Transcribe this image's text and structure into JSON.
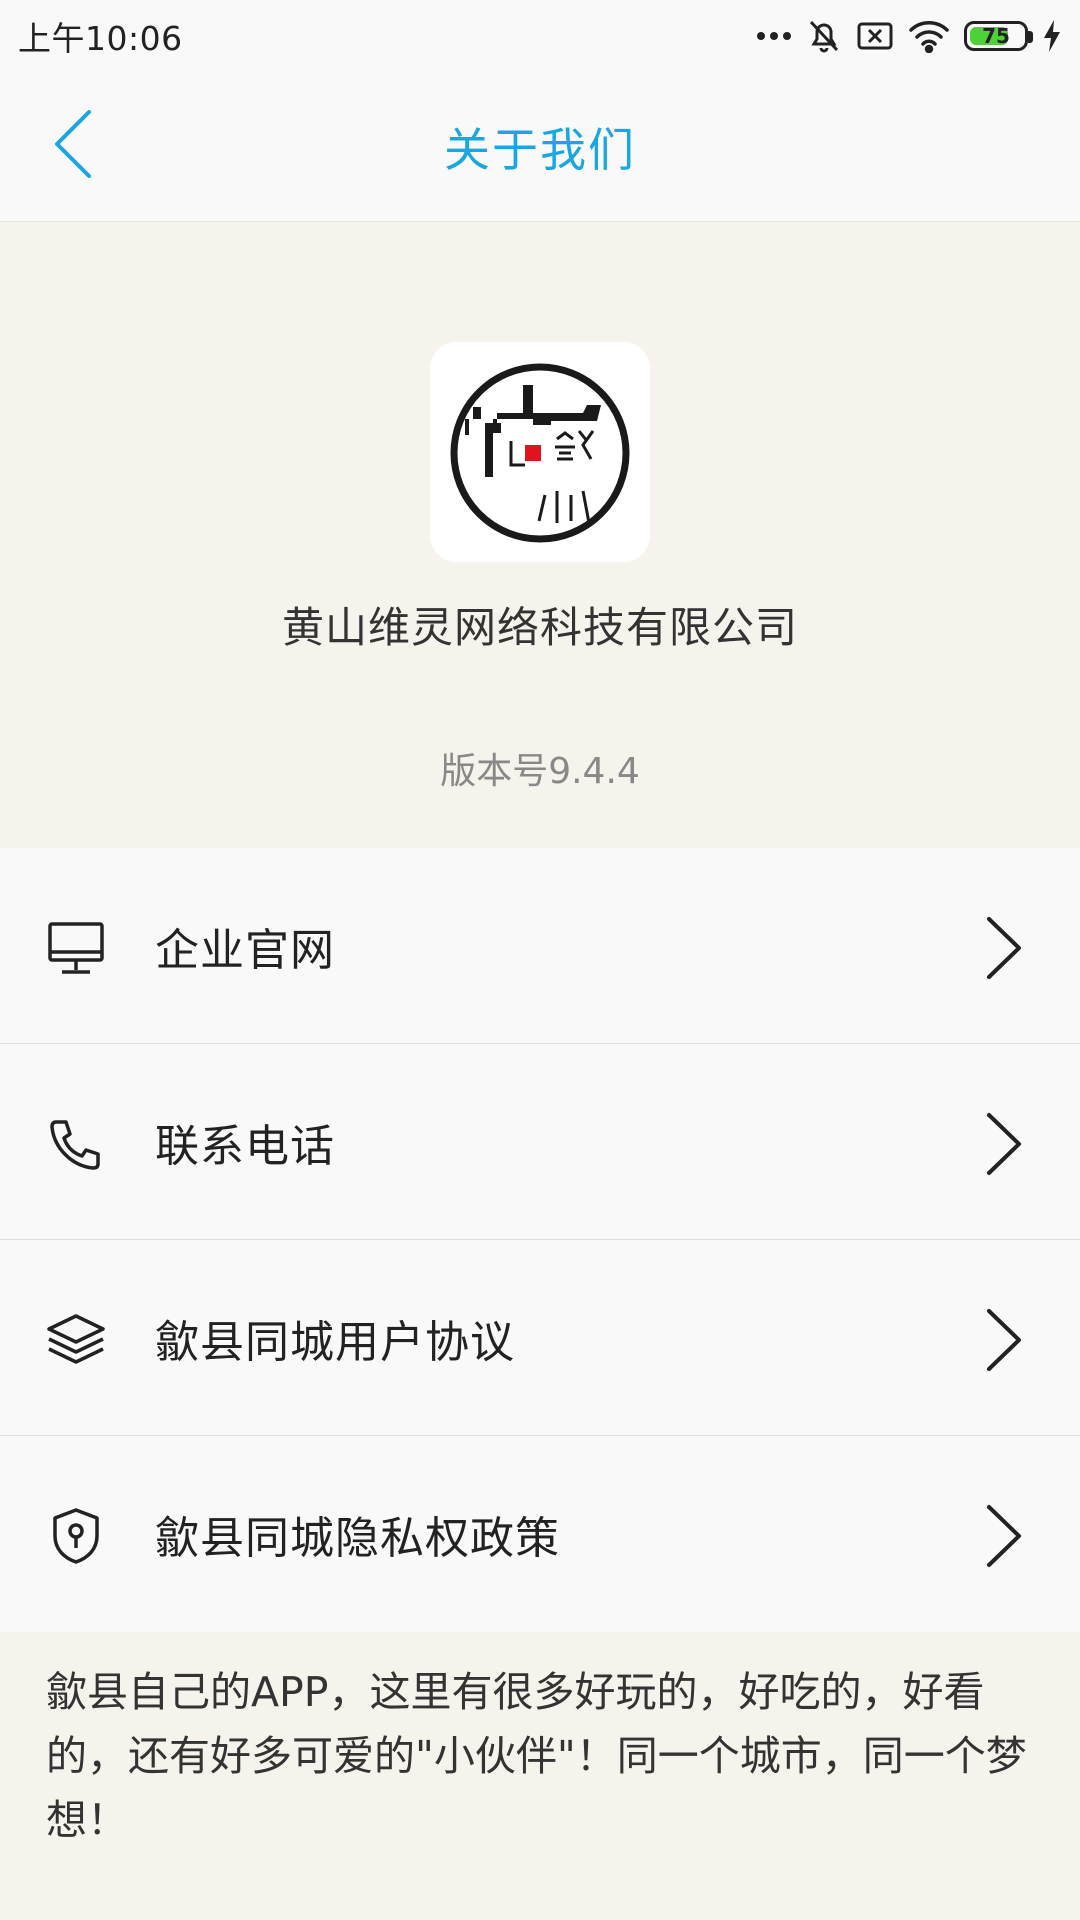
{
  "status_bar": {
    "time": "上午10:06",
    "battery_level": "75",
    "battery_fraction": 0.75,
    "battery_color": "#4cd137"
  },
  "title_bar": {
    "title": "关于我们",
    "title_color": "#1aa6e0",
    "back_icon": "chevron-left-icon"
  },
  "header": {
    "company_name": "黄山维灵网络科技有限公司",
    "version": "版本号9.4.4"
  },
  "menu": {
    "items": [
      {
        "label": "企业官网",
        "icon": "monitor-icon"
      },
      {
        "label": "联系电话",
        "icon": "phone-icon"
      },
      {
        "label": "歙县同城用户协议",
        "icon": "layers-icon"
      },
      {
        "label": "歙县同城隐私权政策",
        "icon": "shield-icon"
      }
    ]
  },
  "description": "歙县自己的APP，这里有很多好玩的，好吃的，好看的，还有好多可爱的\"小伙伴\"！同一个城市，同一个梦想！",
  "colors": {
    "page_background": "#f6f2ec",
    "list_background": "#f9f9f9",
    "logo_accent": "#e0141b"
  }
}
